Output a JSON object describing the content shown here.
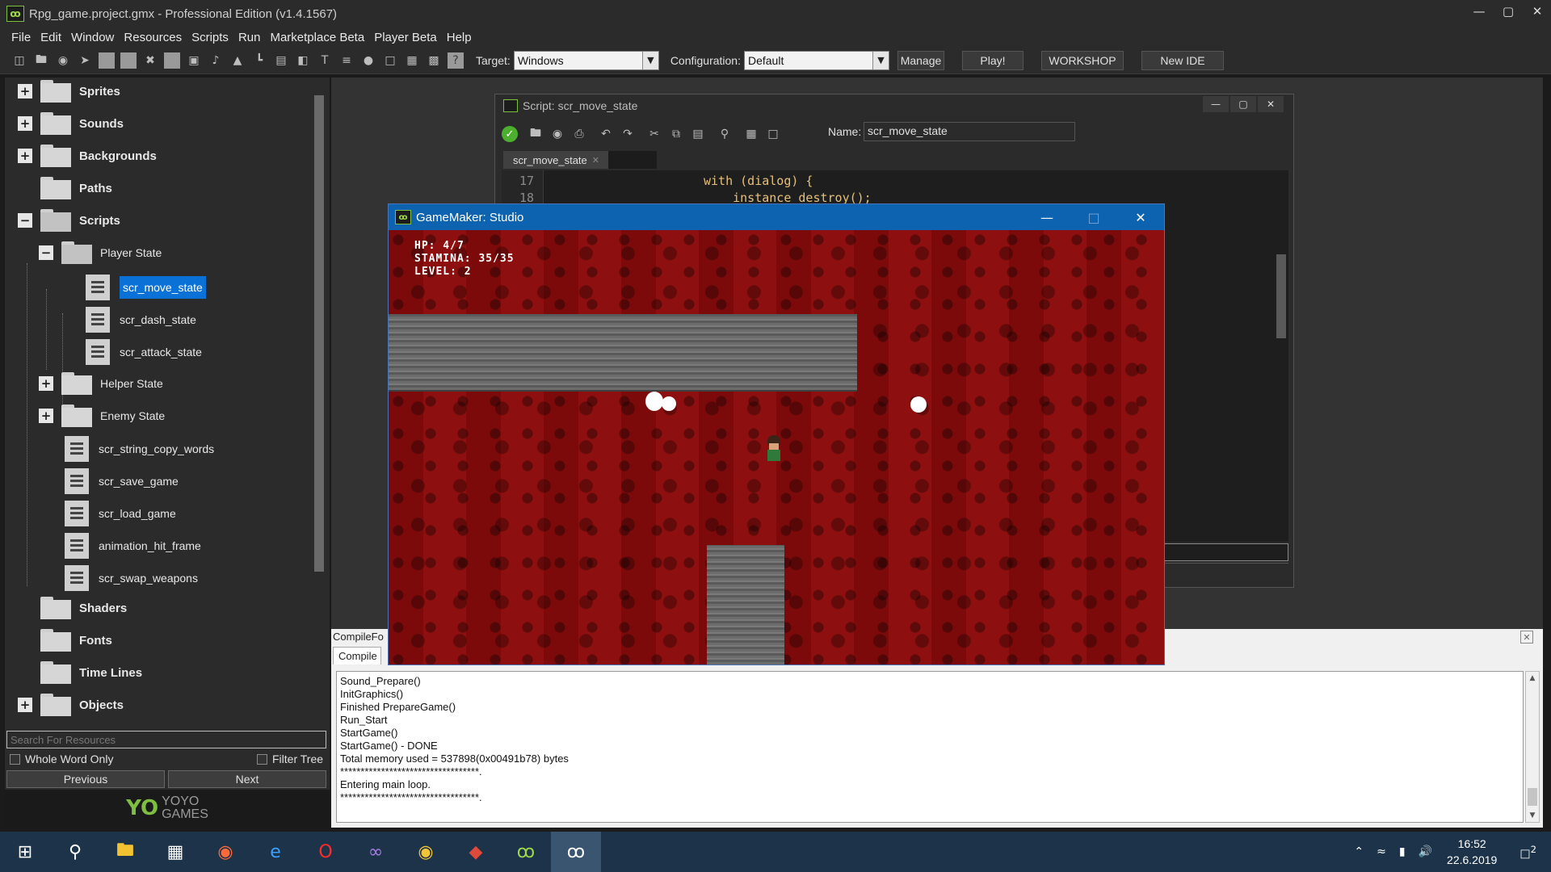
{
  "app": {
    "title": "Rpg_game.project.gmx  -  Professional Edition (v1.4.1567)",
    "icon": "gamemaker-logo-icon"
  },
  "menu": [
    "File",
    "Edit",
    "Window",
    "Resources",
    "Scripts",
    "Run",
    "Marketplace Beta",
    "Player Beta",
    "Help"
  ],
  "toolbar": {
    "target_label": "Target:",
    "target_value": "Windows",
    "config_label": "Configuration:",
    "config_value": "Default",
    "manage": "Manage",
    "play": "Play!",
    "workshop": "WORKSHOP",
    "newide": "New IDE"
  },
  "tree": {
    "sprites": "Sprites",
    "sounds": "Sounds",
    "backgrounds": "Backgrounds",
    "paths": "Paths",
    "scripts": "Scripts",
    "player_state": "Player State",
    "scr_move_state": "scr_move_state",
    "scr_dash_state": "scr_dash_state",
    "scr_attack_state": "scr_attack_state",
    "helper_state": "Helper State",
    "enemy_state": "Enemy State",
    "s1": "scr_string_copy_words",
    "s2": "scr_save_game",
    "s3": "scr_load_game",
    "s4": "animation_hit_frame",
    "s5": "scr_swap_weapons",
    "shaders": "Shaders",
    "fonts": "Fonts",
    "timelines": "Time Lines",
    "objects": "Objects"
  },
  "search": {
    "placeholder": "Search For Resources",
    "whole_word": "Whole Word Only",
    "filter_tree": "Filter Tree",
    "previous": "Previous",
    "next": "Next"
  },
  "brand": {
    "mark": "YO",
    "line1": "YOYO",
    "line2": "GAMES"
  },
  "script_window": {
    "title": "Script: scr_move_state",
    "name_label": "Name:",
    "name_value": "scr_move_state",
    "tab": "scr_move_state",
    "lines": [
      {
        "n": "17",
        "code": "with (dialog) {"
      },
      {
        "n": "18",
        "code": "    instance_destroy();"
      }
    ]
  },
  "output": {
    "header": "CompileFo",
    "tab": "Compile",
    "lines": [
      "Sound_Prepare()",
      "InitGraphics()",
      "Finished PrepareGame()",
      "Run_Start",
      "StartGame()",
      "StartGame() - DONE",
      "Total memory used = 537898(0x00491b78) bytes",
      "**********************************.",
      "Entering main loop.",
      "**********************************."
    ]
  },
  "game": {
    "title": "GameMaker: Studio",
    "hp": "HP: 4/7",
    "stamina": "STAMINA: 35/35",
    "level": "LEVEL: 2"
  },
  "taskbar": {
    "time": "16:52",
    "date": "22.6.2019",
    "notif": "2"
  }
}
